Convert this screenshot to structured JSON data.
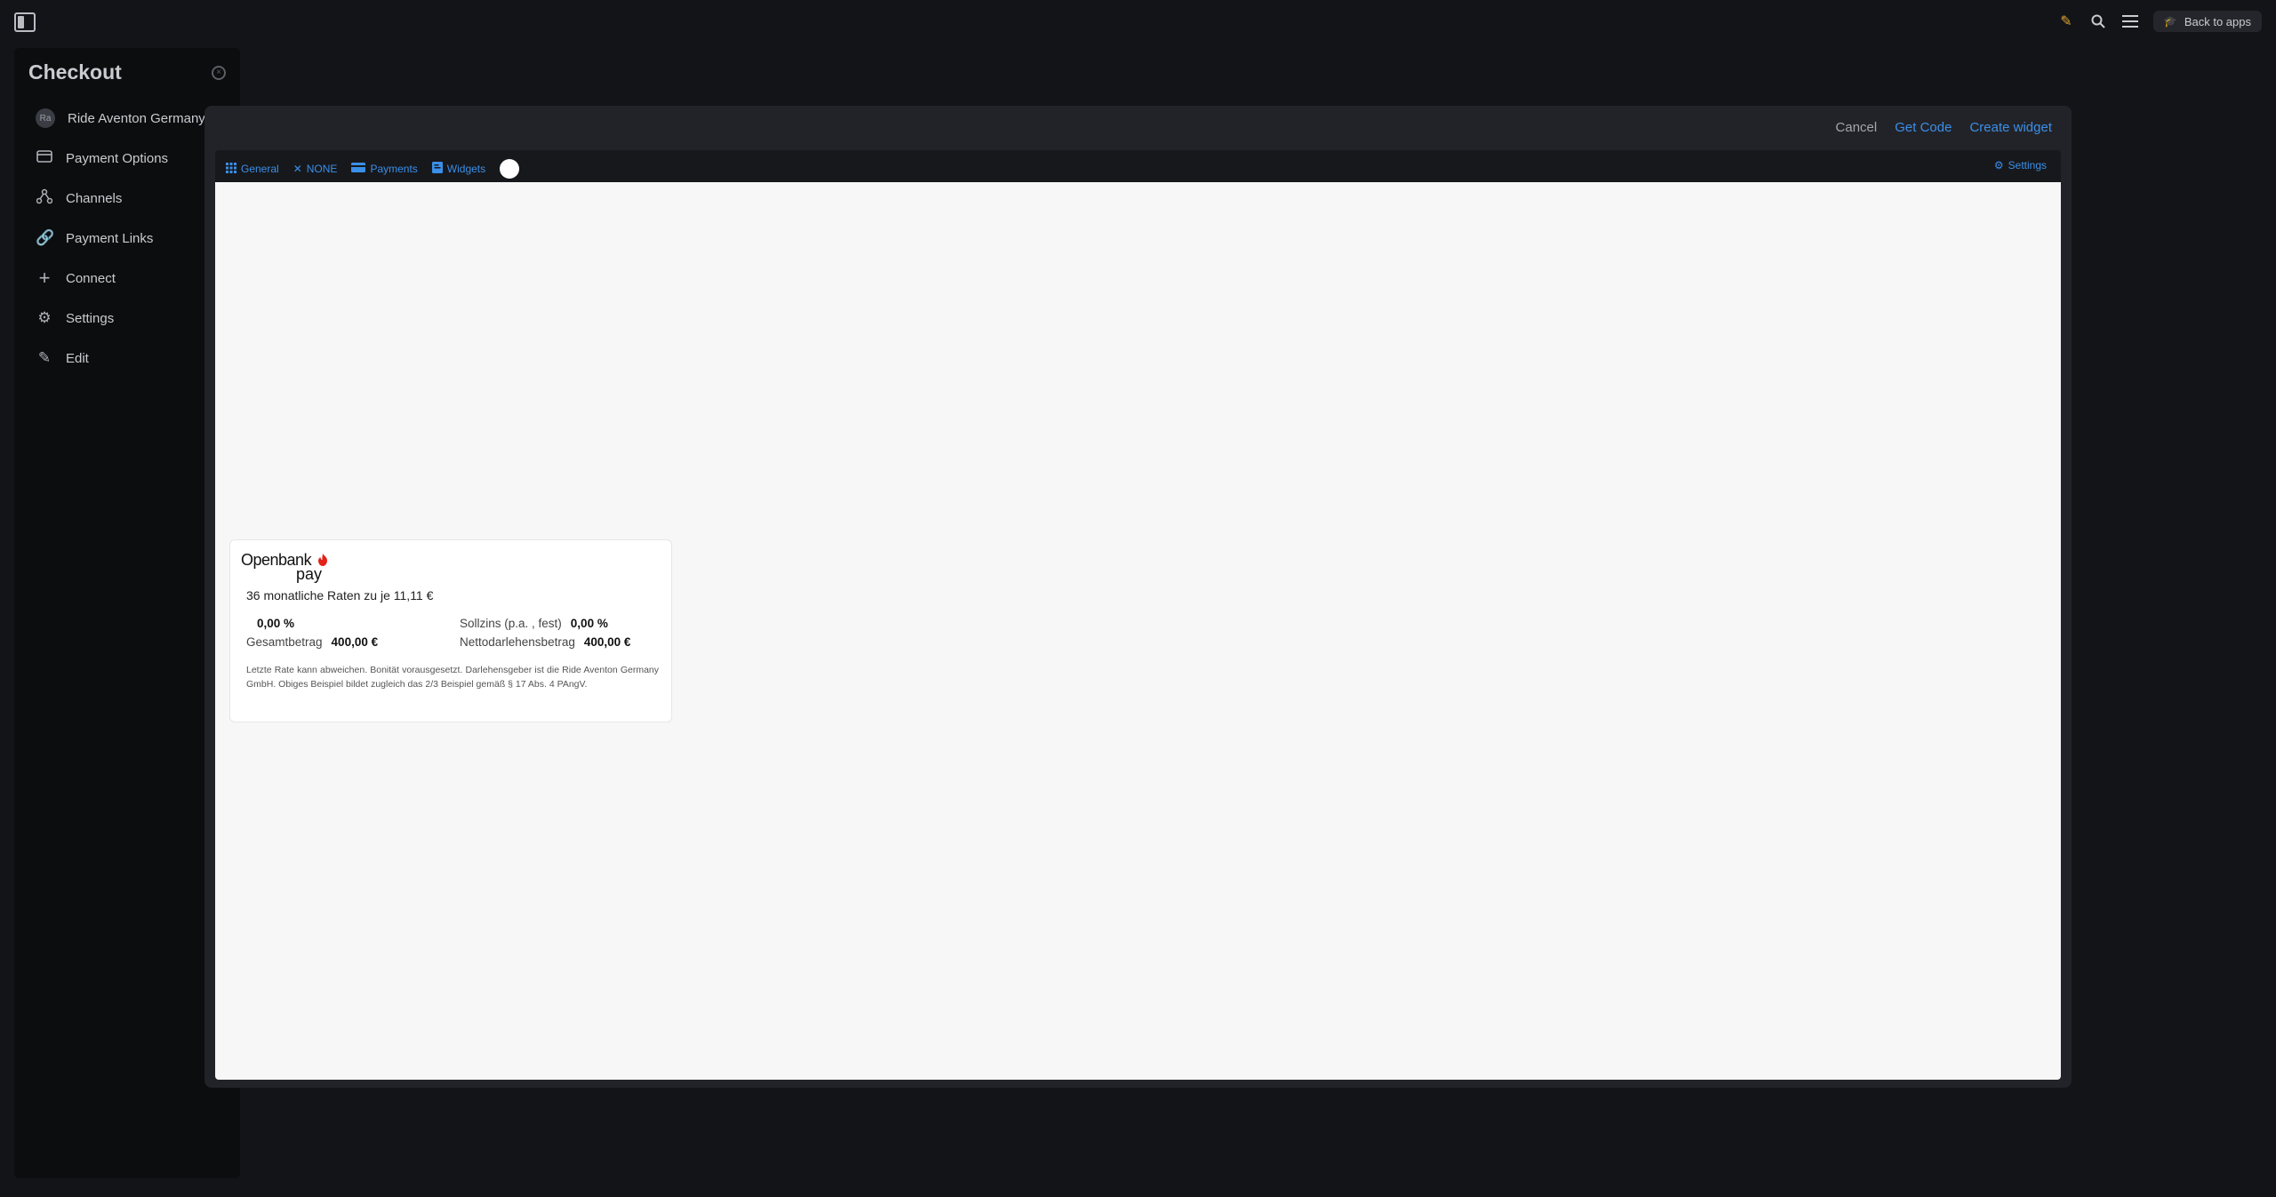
{
  "topbar": {
    "back_label": "Back to apps"
  },
  "sidebar": {
    "title": "Checkout",
    "account": {
      "initials": "Ra",
      "label": "Ride Aventon Germany G"
    },
    "items": [
      {
        "label": "Payment Options",
        "icon": "credit-card-icon"
      },
      {
        "label": "Channels",
        "icon": "channels-icon"
      },
      {
        "label": "Payment Links",
        "icon": "link-icon"
      },
      {
        "label": "Connect",
        "icon": "plus-icon"
      },
      {
        "label": "Settings",
        "icon": "gear-icon"
      },
      {
        "label": "Edit",
        "icon": "pen-icon"
      }
    ]
  },
  "modal": {
    "cancel_label": "Cancel",
    "get_code_label": "Get Code",
    "create_label": "Create widget",
    "tabs": [
      {
        "label": "General",
        "icon": "grid-icon"
      },
      {
        "label": "NONE",
        "icon": "close-icon"
      },
      {
        "label": "Payments",
        "icon": "card-icon"
      },
      {
        "label": "Widgets",
        "icon": "widget-icon"
      }
    ],
    "settings_label": "Settings"
  },
  "widget": {
    "brand_top": "Openbank",
    "brand_bottom": "pay",
    "headline": "36 monatliche Raten zu je 11,11 €",
    "rate_value": "0,00 %",
    "sollzins_label": "Sollzins (p.a. , fest)",
    "sollzins_value": "0,00 %",
    "gesamt_label": "Gesamtbetrag",
    "gesamt_value": "400,00 €",
    "netto_label": "Nettodarlehensbetrag",
    "netto_value": "400,00 €",
    "legal": "Letzte Rate kann abweichen. Bonität vorausgesetzt. Darlehensgeber ist die Ride Aventon Germany GmbH. Obiges Beispiel bildet zugleich das 2/3 Beispiel gemäß § 17 Abs. 4 PAngV.",
    "colors": {
      "brand_red": "#e2231a"
    }
  }
}
